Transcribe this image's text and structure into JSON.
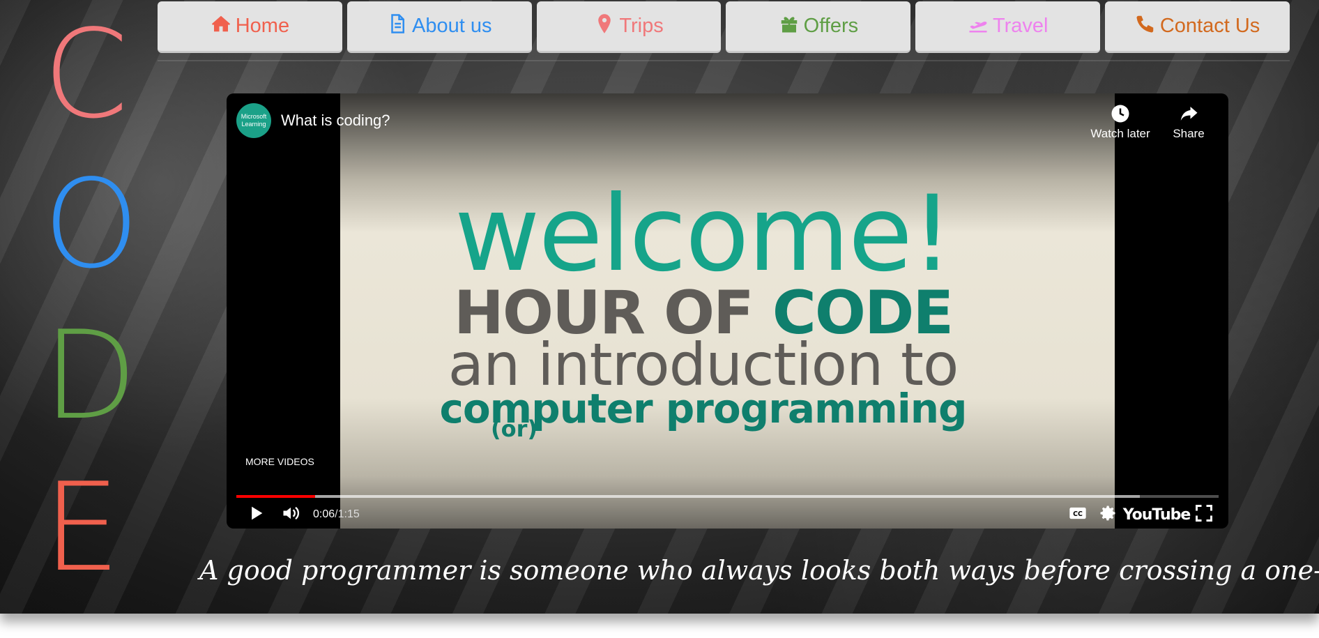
{
  "code_letters": [
    {
      "letter": "C",
      "color": "#f0787a"
    },
    {
      "letter": "O",
      "color": "#2f8ef0"
    },
    {
      "letter": "D",
      "color": "#5f9e45"
    },
    {
      "letter": "E",
      "color": "#f0604d"
    }
  ],
  "nav": {
    "items": [
      {
        "label": "Home",
        "icon": "home-icon",
        "color": "#f0604d"
      },
      {
        "label": "About us",
        "icon": "document-icon",
        "color": "#2f8ef0"
      },
      {
        "label": "Trips",
        "icon": "map-pin-icon",
        "color": "#f0787a"
      },
      {
        "label": "Offers",
        "icon": "gift-icon",
        "color": "#5f9e45"
      },
      {
        "label": "Travel",
        "icon": "plane-departure-icon",
        "color": "#ee82ee"
      },
      {
        "label": "Contact Us",
        "icon": "phone-icon",
        "color": "#d2691e"
      }
    ]
  },
  "video": {
    "channel_avatar_text": "Microsoft Learning",
    "title": "What is coding?",
    "watch_later_label": "Watch later",
    "share_label": "Share",
    "more_videos_label": "MORE VIDEOS",
    "frame_text": {
      "welcome": "welcome!",
      "hour_part1": "HOUR OF ",
      "hour_part2": "CODE",
      "intro": "an introduction to",
      "computer": "computer programming",
      "or": "(or)"
    },
    "current_time": "0:06",
    "duration": "1:15",
    "time_separator": " / ",
    "played_fraction": 0.08,
    "buffered_fraction": 0.92,
    "youtube_label": "YouTube",
    "accent_color": "#ff0000"
  },
  "quote": "A good programmer is someone who always looks both ways before crossing a one-way street."
}
